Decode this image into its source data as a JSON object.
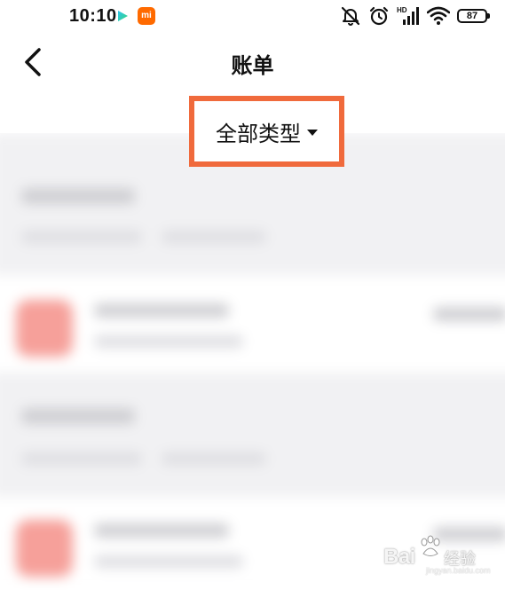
{
  "status_bar": {
    "time": "10:10",
    "app_icons": [
      "play-icon",
      "mi-app-icon"
    ],
    "mi_icon_text": "mi",
    "mi_icon_color": "#ff6a00",
    "indicators": [
      "mute-icon",
      "alarm-icon",
      "hd-signal-icon",
      "wifi-icon",
      "battery-icon"
    ],
    "hd_label": "HD",
    "battery_level": "87"
  },
  "nav": {
    "back_icon": "chevron-left-icon",
    "title": "账单"
  },
  "filter": {
    "label": "全部类型",
    "dropdown_icon": "caret-down-icon",
    "highlight_color": "#f06a3c"
  },
  "watermark": {
    "brand": "Bai",
    "brand_suffix": "经验",
    "site": "jingyan.baidu.com"
  }
}
